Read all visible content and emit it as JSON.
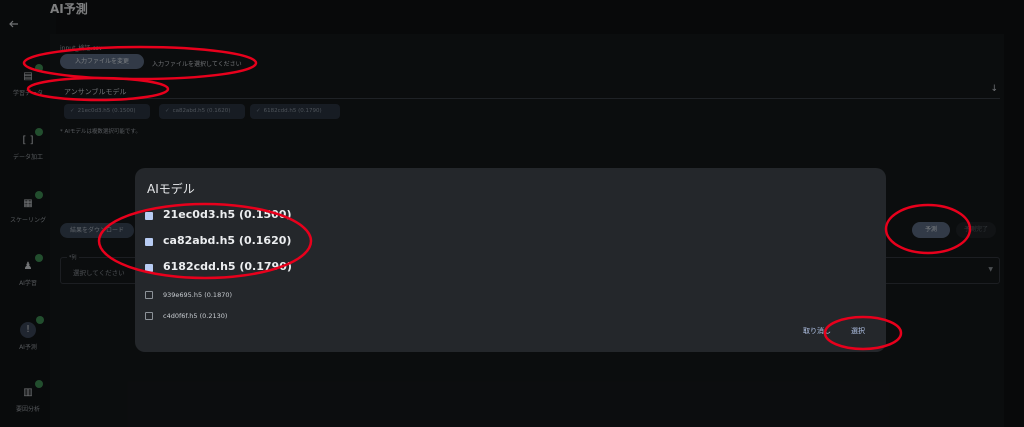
{
  "page": {
    "title": "AI予測",
    "back_icon": "arrow-left-icon"
  },
  "sidebar": {
    "items": [
      {
        "label": "学習データ",
        "icon": "database-icon",
        "done": true,
        "active": false
      },
      {
        "label": "データ加工",
        "icon": "brackets-icon",
        "done": true,
        "active": false
      },
      {
        "label": "スケーリング",
        "icon": "document-icon",
        "done": true,
        "active": false
      },
      {
        "label": "AI学習",
        "icon": "person-icon",
        "done": true,
        "active": false
      },
      {
        "label": "AI予測",
        "icon": "exclamation-icon",
        "done": true,
        "active": true
      },
      {
        "label": "要因分析",
        "icon": "chart-icon",
        "done": true,
        "active": false
      }
    ]
  },
  "input_file": {
    "label": "input_検証.csv",
    "change_button": "入力ファイルを変更",
    "hint": "入力ファイルを選択してください"
  },
  "ensemble": {
    "label": "アンサンブルモデル",
    "arrow_icon": "arrow-down-icon",
    "chips": [
      {
        "label": "21ec0d3.h5 (0.1500)"
      },
      {
        "label": "ca82abd.h5 (0.1620)"
      },
      {
        "label": "6182cdd.h5 (0.1790)"
      }
    ],
    "note": "* AIモデルは複数選択可能です。"
  },
  "actions": {
    "download": "結果をダウンロード",
    "predict": "予測",
    "done": "予測完了"
  },
  "column_select": {
    "legend": "*列",
    "placeholder": "選択してください"
  },
  "dialog": {
    "title": "AIモデル",
    "models": [
      {
        "label": "21ec0d3.h5 (0.1500)",
        "checked": true
      },
      {
        "label": "ca82abd.h5 (0.1620)",
        "checked": true
      },
      {
        "label": "6182cdd.h5 (0.1790)",
        "checked": true
      },
      {
        "label": "939e695.h5 (0.1870)",
        "checked": false
      },
      {
        "label": "c4d0f6f.h5 (0.2130)",
        "checked": false
      }
    ],
    "cancel": "取り消し",
    "confirm": "選択"
  },
  "colors": {
    "annotation": "#e8001c",
    "checkbox_checked": "#b8ccf3",
    "button_primary": "#5b6b82",
    "status_done": "#3e8f54"
  }
}
